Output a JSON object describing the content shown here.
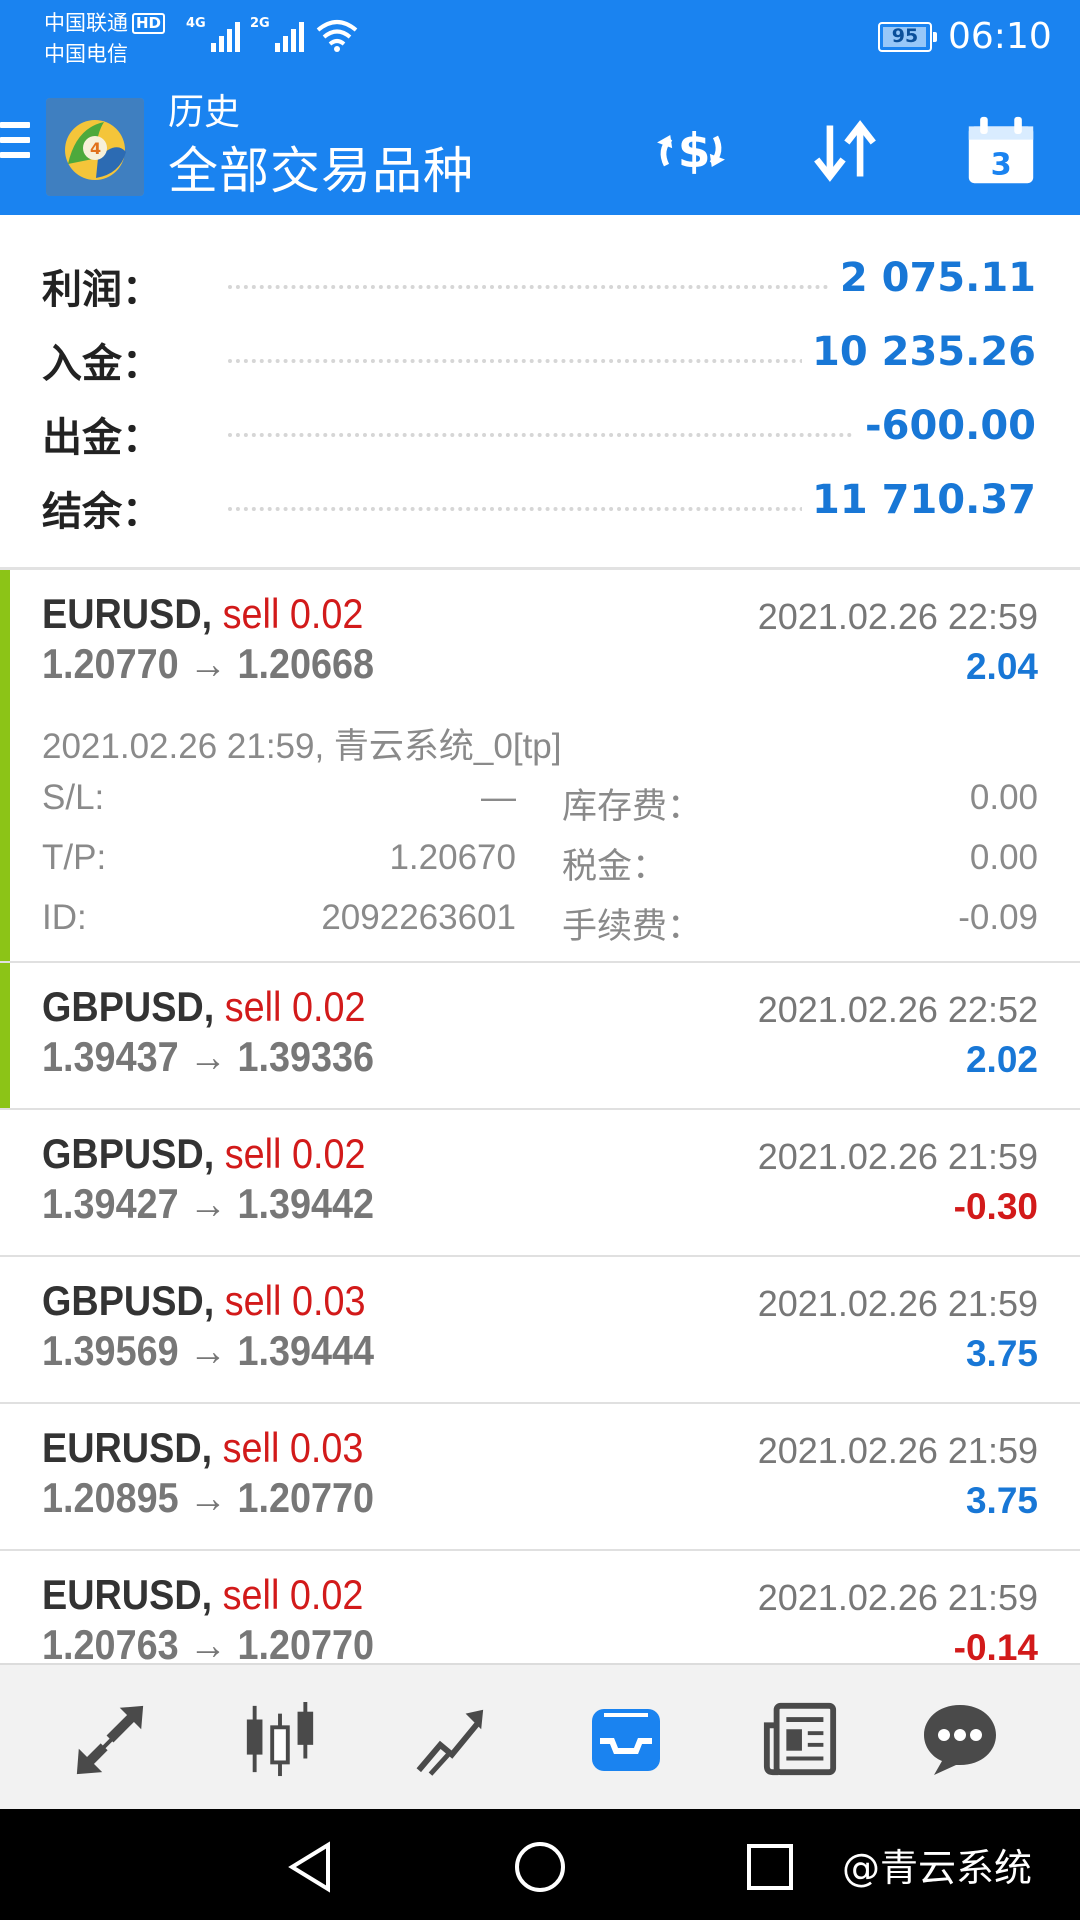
{
  "status_bar": {
    "carrier1": "中国联通",
    "carrier1_badge": "HD",
    "carrier2": "中国电信",
    "net1": "4G",
    "net2": "2G",
    "battery": "95",
    "time": "06:10"
  },
  "app_bar": {
    "title": "历史",
    "subtitle": "全部交易品种",
    "calendar_day": "3",
    "icons": [
      "menu-icon",
      "metatrader-logo",
      "currency-exchange-icon",
      "sort-icon",
      "calendar-icon"
    ]
  },
  "summary": [
    {
      "label": "利润：",
      "value": "2 075.11"
    },
    {
      "label": "入金：",
      "value": "10 235.26"
    },
    {
      "label": "出金：",
      "value": "-600.00"
    },
    {
      "label": "结余：",
      "value": "11 710.37"
    }
  ],
  "deals": [
    {
      "symbol": "EURUSD,",
      "side": "sell 0.02",
      "prices": "1.20770 → 1.20668",
      "time": "2021.02.26 22:59",
      "profit": "2.04",
      "open_info": "2021.02.26 21:59, 青云系统_0[tp]",
      "sl_label": "S/L:",
      "sl_value": "—",
      "tp_label": "T/P:",
      "tp_value": "1.20670",
      "id_label": "ID:",
      "id_value": "2092263601",
      "swap_label": "库存费：",
      "swap_value": "0.00",
      "tax_label": "税金：",
      "tax_value": "0.00",
      "fee_label": "手续费：",
      "fee_value": "-0.09"
    },
    {
      "symbol": "GBPUSD,",
      "side": "sell 0.02",
      "prices": "1.39437 → 1.39336",
      "time": "2021.02.26 22:52",
      "profit": "2.02"
    },
    {
      "symbol": "GBPUSD,",
      "side": "sell 0.02",
      "prices": "1.39427 → 1.39442",
      "time": "2021.02.26 21:59",
      "profit": "-0.30"
    },
    {
      "symbol": "GBPUSD,",
      "side": "sell 0.03",
      "prices": "1.39569 → 1.39444",
      "time": "2021.02.26 21:59",
      "profit": "3.75"
    },
    {
      "symbol": "EURUSD,",
      "side": "sell 0.03",
      "prices": "1.20895 → 1.20770",
      "time": "2021.02.26 21:59",
      "profit": "3.75"
    },
    {
      "symbol": "EURUSD,",
      "side": "sell 0.02",
      "prices": "1.20763 → 1.20770",
      "time": "2021.02.26 21:59",
      "profit": "-0.14"
    }
  ],
  "tab_bar": {
    "tabs": [
      "quotes-tab-icon",
      "chart-tab-icon",
      "trade-tab-icon",
      "history-tab-icon",
      "news-tab-icon",
      "chat-tab-icon"
    ],
    "active_color": "#1a83f0"
  },
  "nav_bar": {
    "watermark": "@青云系统"
  },
  "colors": {
    "primary": "#1a83f0",
    "profit_positive": "#1877d6",
    "sell_red": "#d21a1a",
    "accent_green": "#8cc417"
  }
}
